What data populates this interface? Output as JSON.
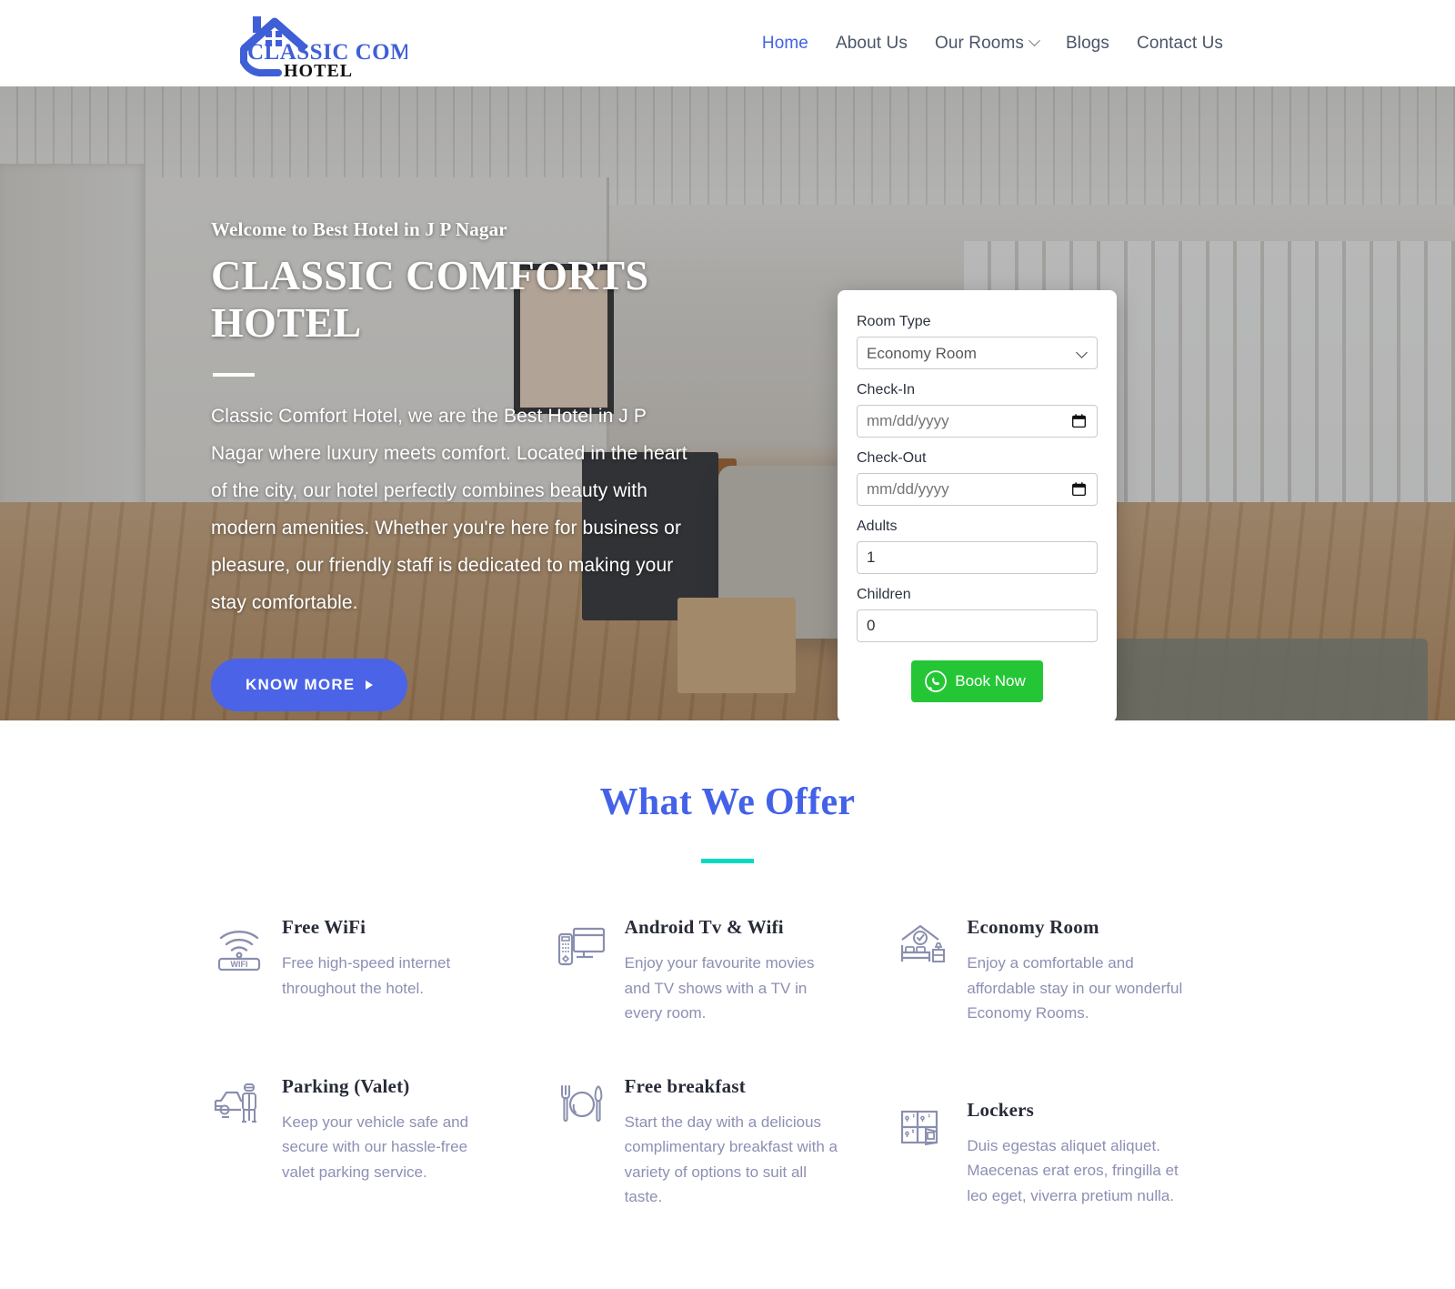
{
  "header": {
    "logo": {
      "name_line1": "CLASSIC COMFORTS",
      "name_line2": "HOTEL",
      "color": "#3f5fd6"
    },
    "nav": [
      {
        "label": "Home",
        "active": true
      },
      {
        "label": "About Us",
        "active": false
      },
      {
        "label": "Our Rooms",
        "active": false,
        "has_dropdown": true
      },
      {
        "label": "Blogs",
        "active": false
      },
      {
        "label": "Contact Us",
        "active": false
      }
    ]
  },
  "hero": {
    "eyebrow": "Welcome to Best Hotel in J P Nagar",
    "title": "CLASSIC COMFORTS HOTEL",
    "paragraph": "Classic Comfort Hotel, we are the Best Hotel in J P Nagar where luxury meets comfort. Located in the heart of the city, our hotel perfectly combines beauty with modern amenities. Whether you're here for business or pleasure, our friendly staff is dedicated to making your stay comfortable.",
    "cta_label": "KNOW MORE",
    "cta_color": "#4a63e7"
  },
  "booking": {
    "room_type": {
      "label": "Room Type",
      "value": "Economy Room",
      "options": [
        "Economy Room"
      ]
    },
    "check_in": {
      "label": "Check-In",
      "placeholder": "mm/dd/yyyy",
      "value": ""
    },
    "check_out": {
      "label": "Check-Out",
      "placeholder": "mm/dd/yyyy",
      "value": ""
    },
    "adults": {
      "label": "Adults",
      "value": "1"
    },
    "children": {
      "label": "Children",
      "value": "0"
    },
    "submit": {
      "label": "Book Now",
      "icon": "whatsapp-icon",
      "color": "#25c636"
    }
  },
  "offers": {
    "title": "What We Offer",
    "title_color": "#4362e8",
    "rule_color": "#06dbc2",
    "items": [
      {
        "icon": "wifi-icon",
        "title": "Free WiFi",
        "desc": "Free high-speed internet throughout the hotel."
      },
      {
        "icon": "tv-remote-icon",
        "title": "Android Tv & Wifi",
        "desc": "Enjoy your favourite movies and TV shows with a TV in every room."
      },
      {
        "icon": "bed-room-icon",
        "title": "Economy Room",
        "desc": "Enjoy a comfortable and affordable stay in our wonderful Economy Rooms."
      },
      {
        "icon": "valet-parking-icon",
        "title": "Parking (Valet)",
        "desc": "Keep your vehicle safe and secure with our hassle-free valet parking service."
      },
      {
        "icon": "cutlery-icon",
        "title": "Free breakfast",
        "desc": "Start the day with a delicious complimentary breakfast with a variety of options to suit all taste."
      },
      {
        "icon": "lockers-icon",
        "title": "Lockers",
        "desc": "Duis egestas aliquet aliquet. Maecenas erat eros, fringilla et leo eget, viverra pretium nulla."
      }
    ]
  }
}
